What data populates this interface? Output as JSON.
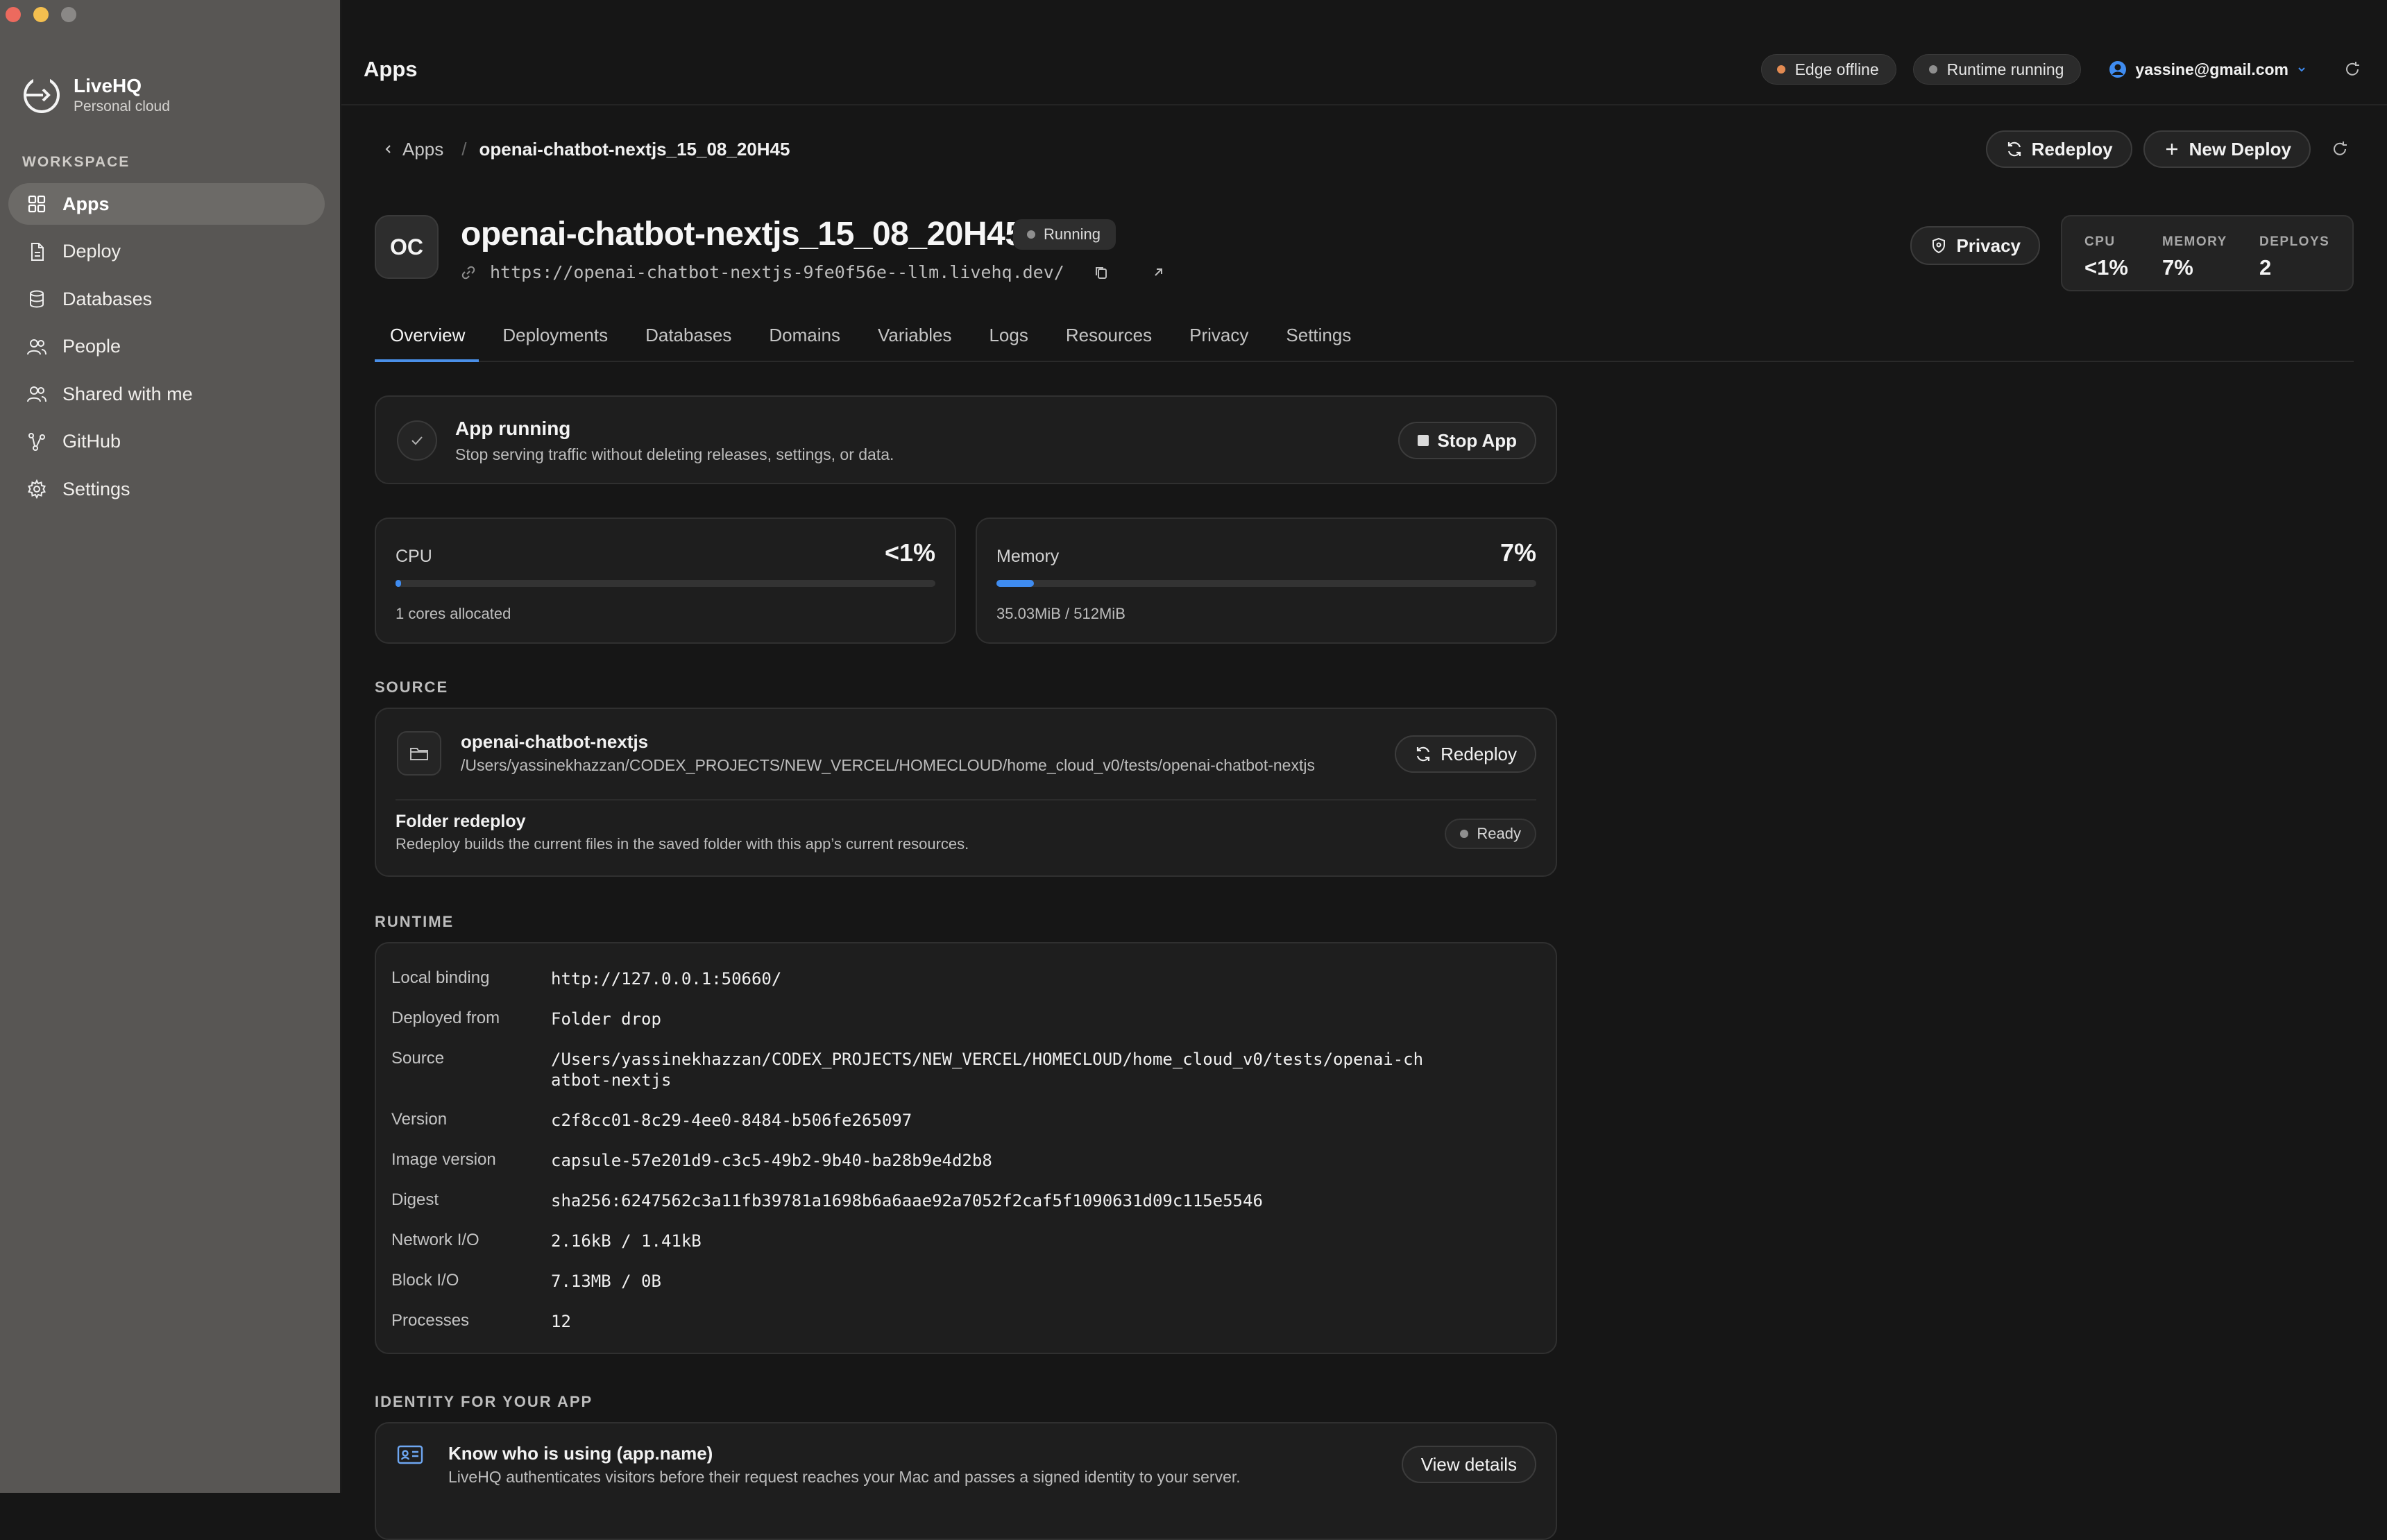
{
  "sidebar": {
    "brand_name": "LiveHQ",
    "brand_sub": "Personal cloud",
    "section_label": "WORKSPACE",
    "items": [
      {
        "label": "Apps",
        "icon": "grid-icon",
        "active": true
      },
      {
        "label": "Deploy",
        "icon": "document-icon"
      },
      {
        "label": "Databases",
        "icon": "database-icon"
      },
      {
        "label": "People",
        "icon": "people-icon"
      },
      {
        "label": "Shared with me",
        "icon": "people-icon"
      },
      {
        "label": "GitHub",
        "icon": "branch-icon"
      },
      {
        "label": "Settings",
        "icon": "gear-icon"
      }
    ]
  },
  "topbar": {
    "title": "Apps",
    "edge_status": "Edge offline",
    "runtime_status": "Runtime running",
    "user_email": "yassine@gmail.com"
  },
  "breadcrumb": {
    "back_label": "Apps",
    "separator": "/",
    "current": "openai-chatbot-nextjs_15_08_20H45"
  },
  "actions": {
    "redeploy_label": "Redeploy",
    "new_deploy_label": "New Deploy"
  },
  "app": {
    "initials": "OC",
    "name": "openai-chatbot-nextjs_15_08_20H45",
    "status": "Running",
    "url": "https://openai-chatbot-nextjs-9fe0f56e--llm.livehq.dev/",
    "privacy_label": "Privacy",
    "stats": {
      "cpu_label": "CPU",
      "cpu_value": "<1%",
      "memory_label": "MEMORY",
      "memory_value": "7%",
      "deploys_label": "DEPLOYS",
      "deploys_value": "2"
    }
  },
  "tabs": [
    "Overview",
    "Deployments",
    "Databases",
    "Domains",
    "Variables",
    "Logs",
    "Resources",
    "Privacy",
    "Settings"
  ],
  "run_card": {
    "title": "App running",
    "subtitle": "Stop serving traffic without deleting releases, settings, or data.",
    "stop_label": "Stop App"
  },
  "resources": {
    "cpu": {
      "label": "CPU",
      "value": "<1%",
      "fill_percent": 1,
      "sub": "1 cores allocated"
    },
    "memory": {
      "label": "Memory",
      "value": "7%",
      "fill_percent": 7,
      "sub": "35.03MiB / 512MiB"
    }
  },
  "source": {
    "section_label": "SOURCE",
    "name": "openai-chatbot-nextjs",
    "path": "/Users/yassinekhazzan/CODEX_PROJECTS/NEW_VERCEL/HOMECLOUD/home_cloud_v0/tests/openai-chatbot-nextjs",
    "redeploy_label": "Redeploy",
    "folder_title": "Folder redeploy",
    "folder_sub": "Redeploy builds the current files in the saved folder with this app’s current resources.",
    "ready_label": "Ready"
  },
  "runtime": {
    "section_label": "RUNTIME",
    "rows": [
      {
        "key": "Local binding",
        "value": "http://127.0.0.1:50660/"
      },
      {
        "key": "Deployed from",
        "value": "Folder drop"
      },
      {
        "key": "Source",
        "value": "/Users/yassinekhazzan/CODEX_PROJECTS/NEW_VERCEL/HOMECLOUD/home_cloud_v0/tests/openai-chatbot-nextjs"
      },
      {
        "key": "Version",
        "value": "c2f8cc01-8c29-4ee0-8484-b506fe265097"
      },
      {
        "key": "Image version",
        "value": "capsule-57e201d9-c3c5-49b2-9b40-ba28b9e4d2b8"
      },
      {
        "key": "Digest",
        "value": "sha256:6247562c3a11fb39781a1698b6a6aae92a7052f2caf5f1090631d09c115e5546"
      },
      {
        "key": "Network I/O",
        "value": "2.16kB / 1.41kB"
      },
      {
        "key": "Block I/O",
        "value": "7.13MB / 0B"
      },
      {
        "key": "Processes",
        "value": "12"
      }
    ]
  },
  "identity": {
    "section_label": "IDENTITY FOR YOUR APP",
    "title": "Know who is using (app.name)",
    "subtitle": "LiveHQ authenticates visitors before their request reaches your Mac and passes a signed identity to your server.",
    "button_label": "View details"
  },
  "colors": {
    "accent": "#3f8cf0",
    "edge_dot": "#e38b52",
    "runtime_dot": "#8f8f8f",
    "traffic_red": "#ec6a5e",
    "traffic_yellow": "#f4bf4f",
    "traffic_gray": "#6f6d6b"
  }
}
